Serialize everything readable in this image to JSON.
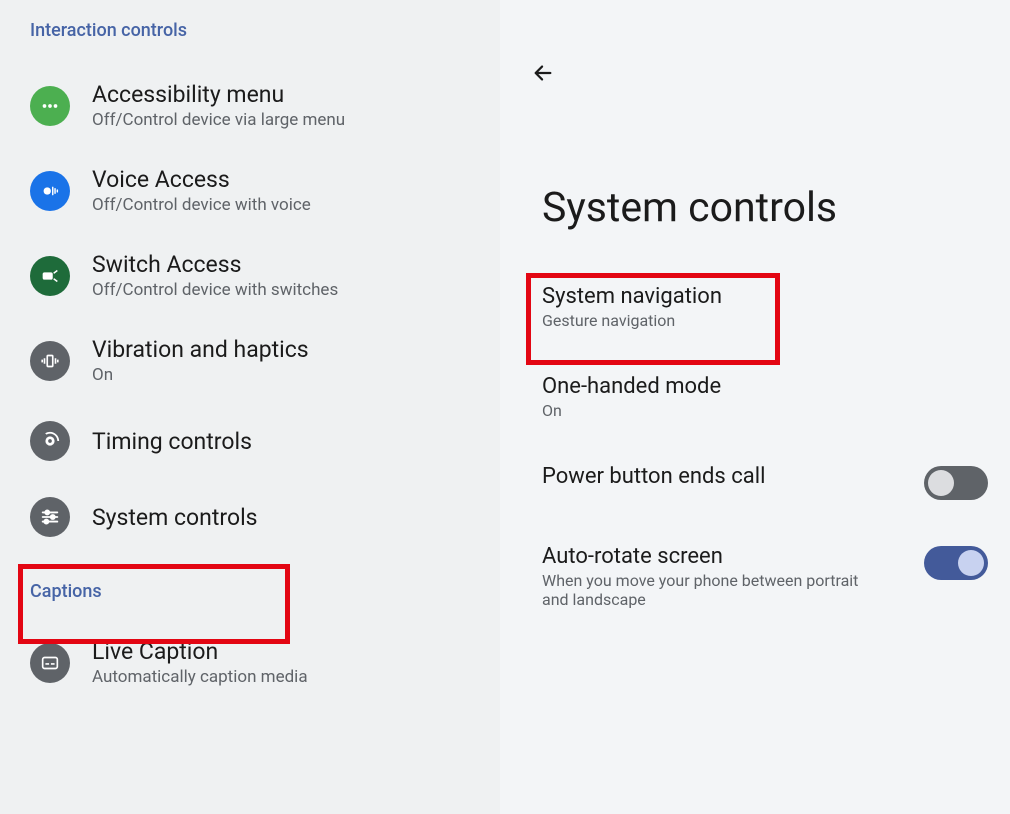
{
  "left": {
    "section1": "Interaction controls",
    "items": [
      {
        "title": "Accessibility menu",
        "sub": "Off/Control device via large menu"
      },
      {
        "title": "Voice Access",
        "sub": "Off/Control device with voice"
      },
      {
        "title": "Switch Access",
        "sub": "Off/Control device with switches"
      },
      {
        "title": "Vibration and haptics",
        "sub": "On"
      },
      {
        "title": "Timing controls",
        "sub": ""
      },
      {
        "title": "System controls",
        "sub": ""
      }
    ],
    "section2": "Captions",
    "captions": [
      {
        "title": "Live Caption",
        "sub": "Automatically caption media"
      }
    ]
  },
  "right": {
    "title": "System controls",
    "rows": [
      {
        "title": "System navigation",
        "sub": "Gesture navigation",
        "switch": null
      },
      {
        "title": "One-handed mode",
        "sub": "On",
        "switch": null
      },
      {
        "title": "Power button ends call",
        "sub": "",
        "switch": "off"
      },
      {
        "title": "Auto-rotate screen",
        "sub": "When you move your phone between portrait and landscape",
        "switch": "on"
      }
    ]
  }
}
